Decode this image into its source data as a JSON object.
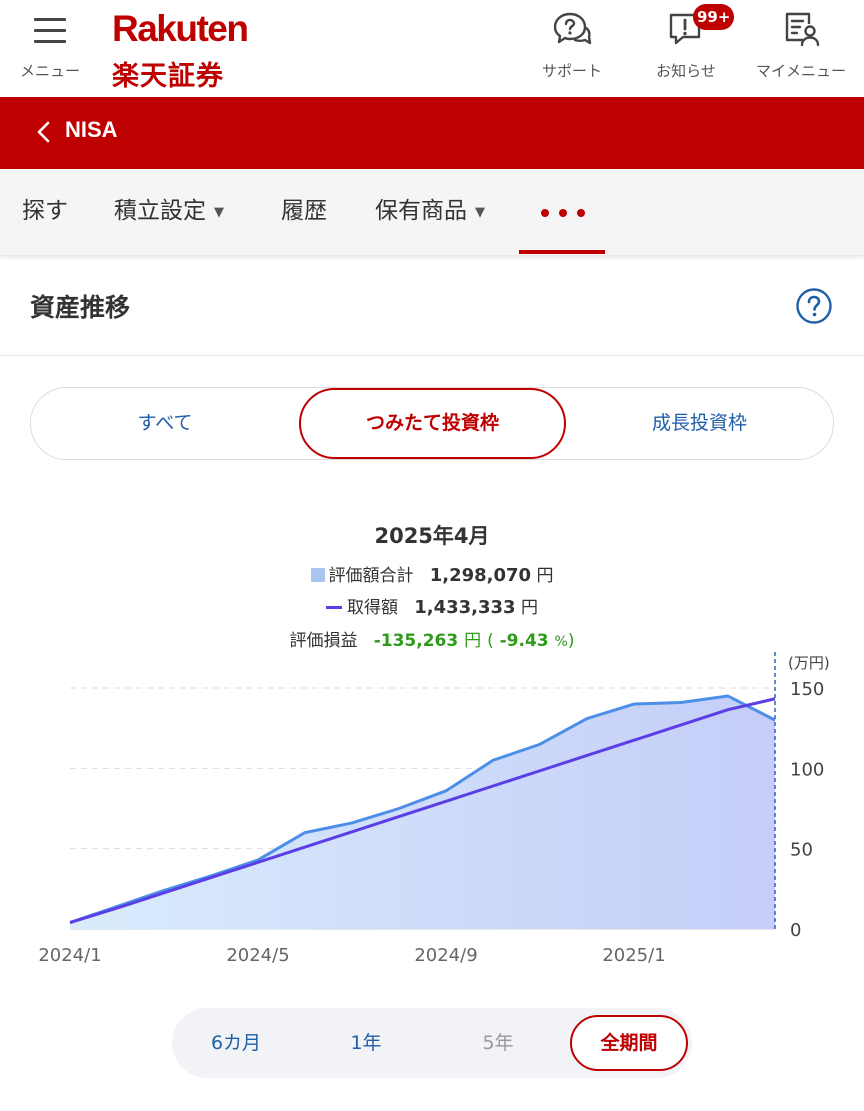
{
  "header": {
    "menu_label": "メニュー",
    "logo_en": "Rakuten",
    "logo_jp": "楽天証券",
    "support_label": "サポート",
    "notice_label": "お知らせ",
    "notice_badge": "99+",
    "mymenu_label": "マイメニュー"
  },
  "nav": {
    "title": "NISA"
  },
  "tabs": [
    {
      "label": "探す"
    },
    {
      "label": "積立設定",
      "has_dropdown": true
    },
    {
      "label": "履歴"
    },
    {
      "label": "保有商品",
      "has_dropdown": true
    },
    {
      "label": "more",
      "icon": "more-dots-icon",
      "active": true
    }
  ],
  "section": {
    "title": "資産推移",
    "help_icon": "help-icon"
  },
  "segment": {
    "items": [
      "すべて",
      "つみたて投資枠",
      "成長投資枠"
    ],
    "selected": "つみたて投資枠"
  },
  "summary": {
    "date": "2025年4月",
    "valuation_label": "評価額合計",
    "valuation_value": "1,298,070",
    "acquisition_label": "取得額",
    "acquisition_value": "1,433,333",
    "pl_label": "評価損益",
    "pl_value": "-135,263",
    "pl_pct": "-9.43",
    "yen": "円",
    "pct_sign": "%",
    "paren_open": "(",
    "paren_close": ")"
  },
  "chart_data": {
    "type": "area",
    "unit_label": "(万円)",
    "x_tick_labels": [
      "2024/1",
      "2024/5",
      "2024/9",
      "2025/1"
    ],
    "x": [
      "2024/1",
      "2024/2",
      "2024/3",
      "2024/4",
      "2024/5",
      "2024/6",
      "2024/7",
      "2024/8",
      "2024/9",
      "2024/10",
      "2024/11",
      "2024/12",
      "2025/1",
      "2025/2",
      "2025/3",
      "2025/4"
    ],
    "y_ticks": [
      0,
      50,
      100,
      150
    ],
    "ylim": [
      0,
      150
    ],
    "grid": true,
    "series": [
      {
        "name": "評価額合計",
        "style": "area",
        "color": "#4d8fe8",
        "values": [
          4,
          14,
          24,
          33,
          43,
          60,
          66,
          75,
          86,
          105,
          115,
          131,
          140,
          141,
          145,
          130
        ]
      },
      {
        "name": "取得額",
        "style": "line",
        "color": "#5a3ee6",
        "values": [
          4,
          13,
          22.5,
          32,
          41.5,
          51,
          60.5,
          70,
          79.5,
          89,
          98.5,
          108,
          117.5,
          127,
          136.5,
          143.3
        ]
      }
    ],
    "highlight_index": 15
  },
  "periods": {
    "items": [
      "6カ月",
      "1年",
      "5年",
      "全期間"
    ],
    "selected": "全期間",
    "disabled": [
      "5年"
    ]
  },
  "colors": {
    "brand": "#bf0000",
    "link": "#1f5fa8",
    "positive_text": "#2f9a1b"
  }
}
